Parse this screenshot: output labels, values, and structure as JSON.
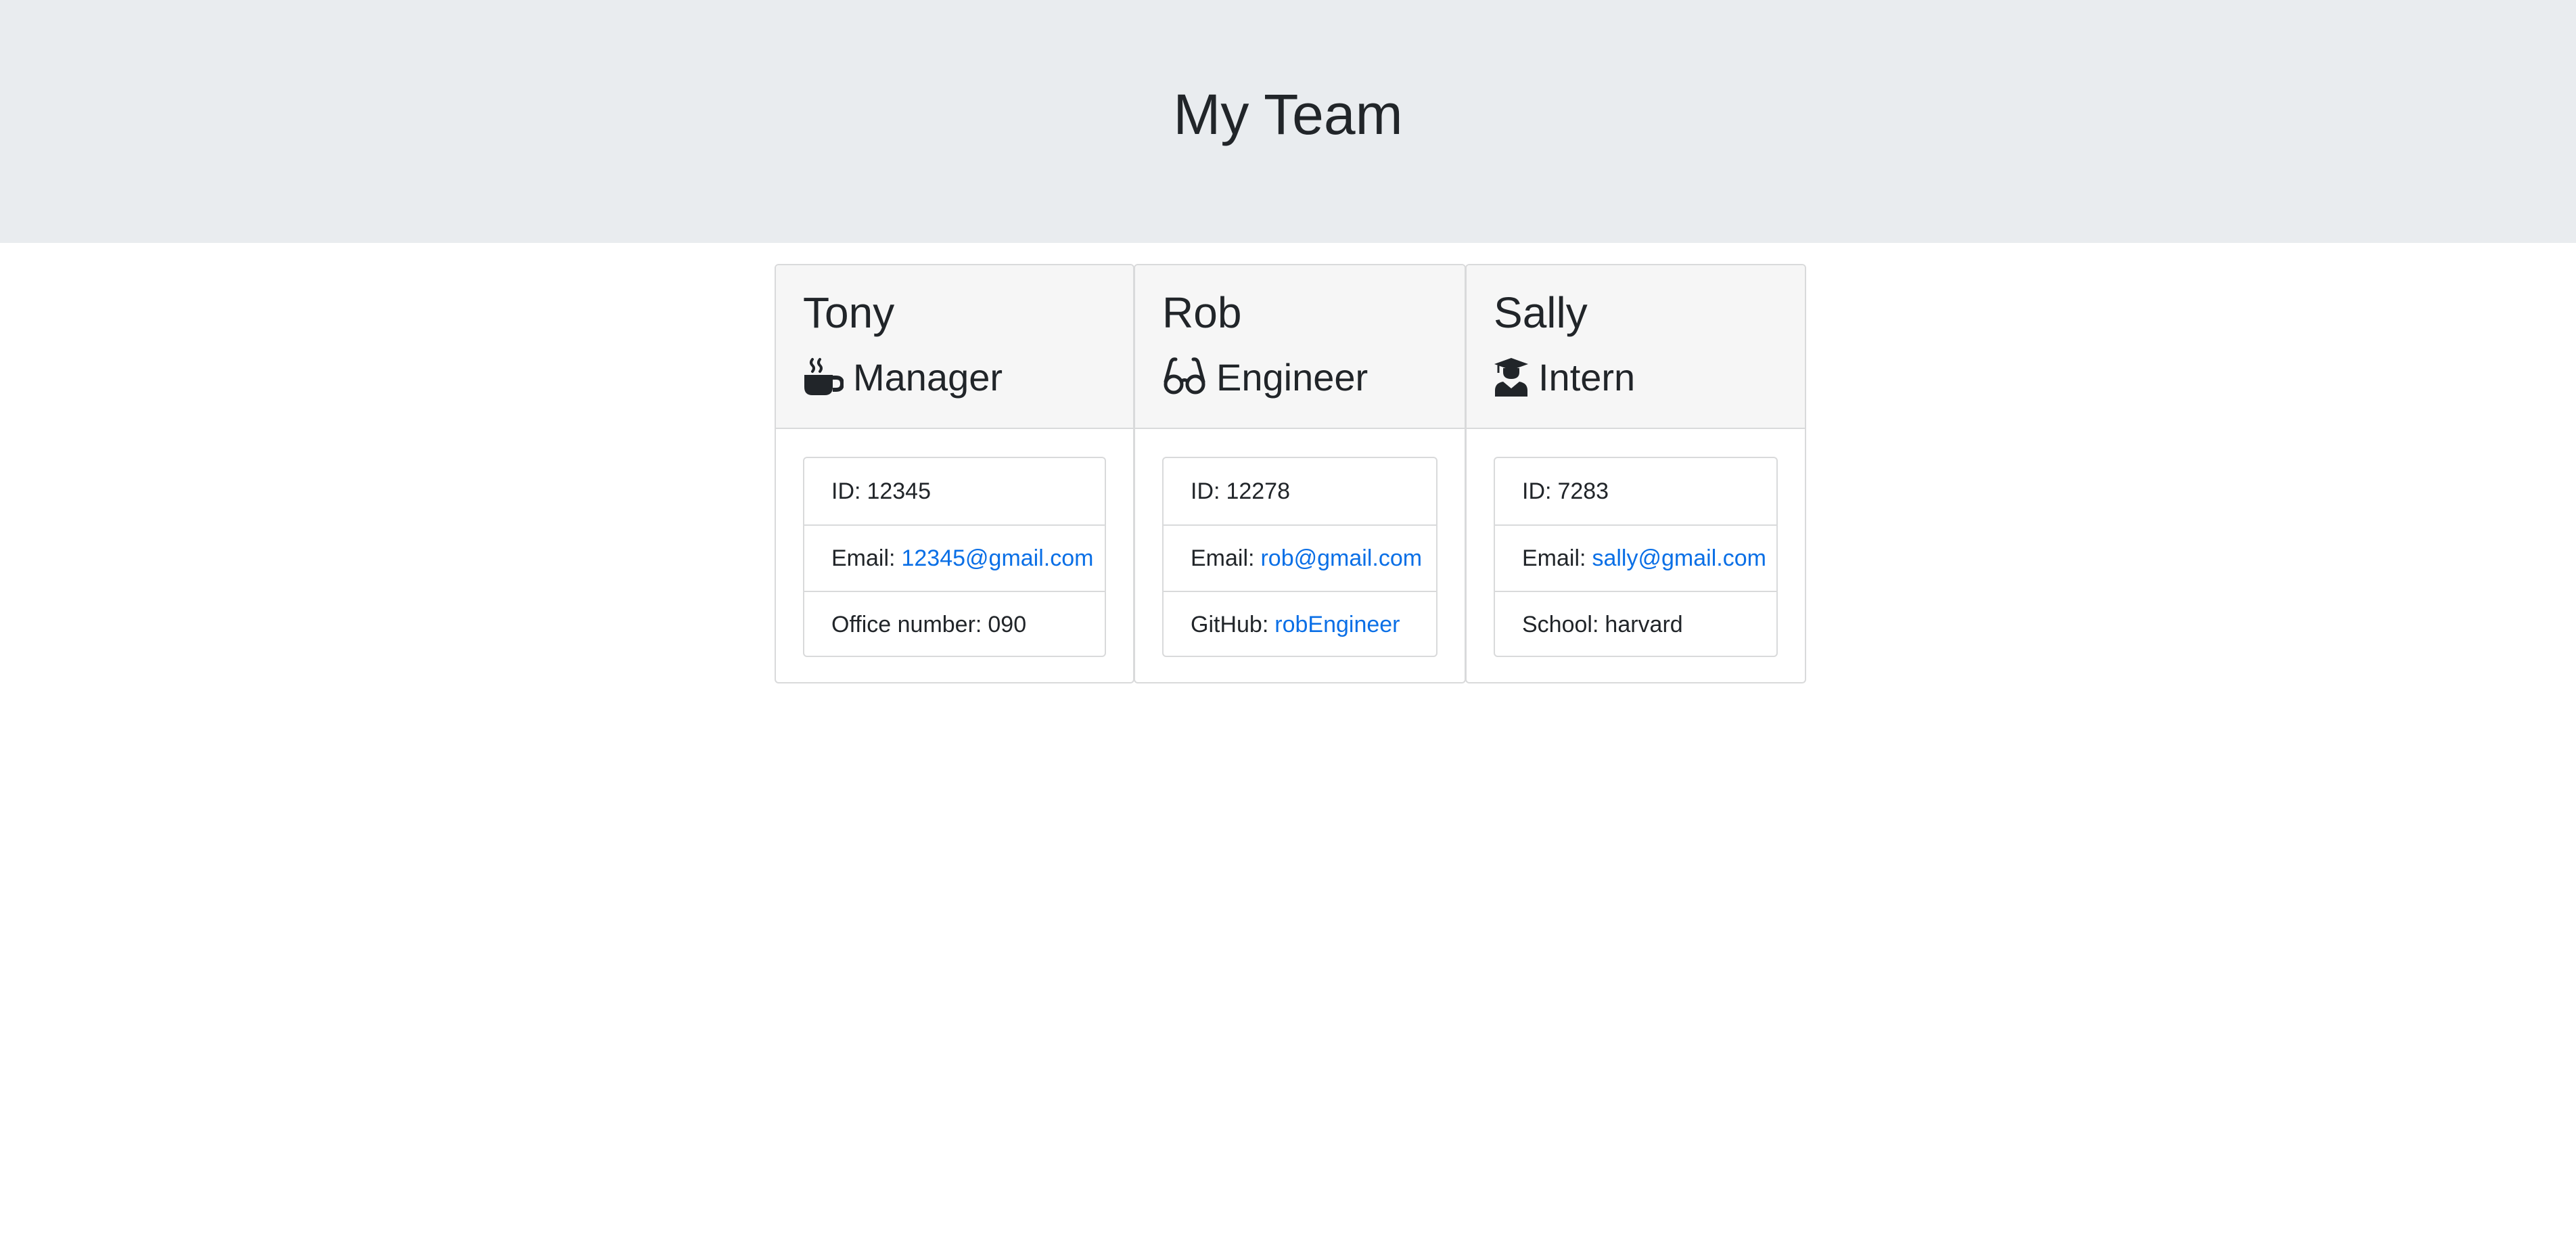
{
  "header": {
    "title": "My Team"
  },
  "colors": {
    "jumbotron_bg": "#e9ecef",
    "card_header_bg": "#f6f6f6",
    "link": "#0a6fe6",
    "text": "#212529"
  },
  "employees": [
    {
      "name": "Tony",
      "role": "Manager",
      "role_icon": "mug-hot-icon",
      "id_label": "ID:",
      "id": "12345",
      "email_label": "Email:",
      "email": "12345@gmail.com",
      "extra_label": "Office number:",
      "extra_value": "090"
    },
    {
      "name": "Rob",
      "role": "Engineer",
      "role_icon": "glasses-icon",
      "id_label": "ID:",
      "id": "12278",
      "email_label": "Email:",
      "email": "rob@gmail.com",
      "extra_label": "GitHub:",
      "extra_value": "robEngineer"
    },
    {
      "name": "Sally",
      "role": "Intern",
      "role_icon": "graduate-icon",
      "id_label": "ID:",
      "id": "7283",
      "email_label": "Email:",
      "email": "sally@gmail.com",
      "extra_label": "School:",
      "extra_value": "harvard"
    }
  ]
}
